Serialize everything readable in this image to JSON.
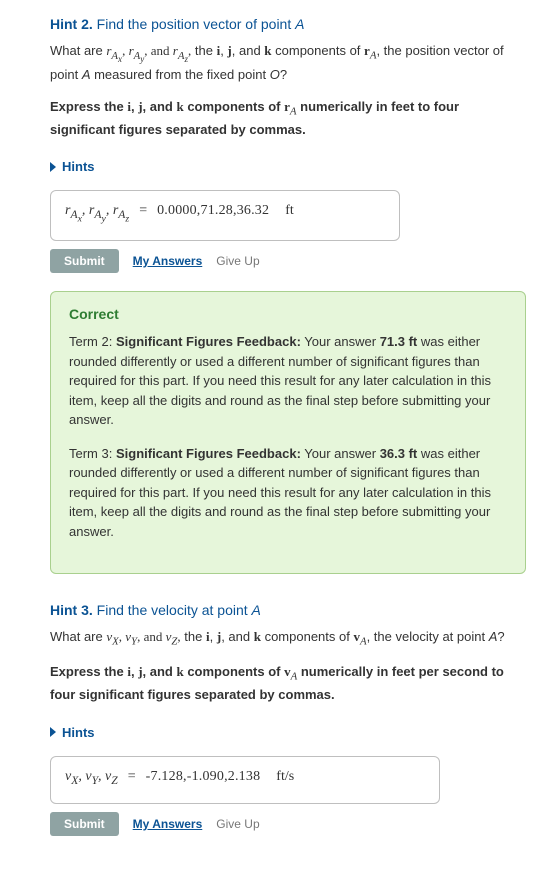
{
  "hint2": {
    "title_prefix": "Hint 2.",
    "title_rest": " Find the position vector of point ",
    "title_var": "A",
    "question_pre": "What are ",
    "vars_display": "r_{A_x}, r_{A_y}, and r_{A_z},",
    "question_mid": " the ",
    "ijk": "i, j, and k",
    "question_after_ijk": " components of ",
    "rA": "r_A",
    "question_tail": ", the position vector of point ",
    "A": "A",
    "question_end": " measured from the fixed point ",
    "O": "O",
    "qmark": "?",
    "instructions": "Express the i, j, and k components of r_A numerically in feet to four significant figures separated by commas.",
    "hints_label": "Hints",
    "answer_vars": "r_{A_x}, r_{A_y}, r_{A_z}",
    "answer_value": "0.0000,71.28,36.32",
    "answer_unit": "ft",
    "submit": "Submit",
    "my_answers": "My Answers",
    "give_up": "Give Up"
  },
  "feedback": {
    "correct": "Correct",
    "term2_label": "Term 2:",
    "sff_label": "Significant Figures Feedback:",
    "term2_lead": " Your answer ",
    "term2_val": "71.3 ft",
    "term2_tail": " was either rounded differently or used a different number of significant figures than required for this part. If you need this result for any later calculation in this item, keep all the digits and round as the final step before submitting your answer.",
    "term3_label": "Term 3:",
    "term3_val": "36.3 ft",
    "term3_tail": " was either rounded differently or used a different number of significant figures than required for this part. If you need this result for any later calculation in this item, keep all the digits and round as the final step before submitting your answer."
  },
  "hint3": {
    "title_prefix": "Hint 3.",
    "title_rest": " Find the velocity at point ",
    "title_var": "A",
    "question_pre": "What are ",
    "vars_display": "v_X, v_Y, and v_Z,",
    "question_mid": " the ",
    "ijk": "i, j, and k",
    "question_after_ijk": " components of ",
    "vA": "v_A",
    "question_tail": ", the velocity at point ",
    "A": "A",
    "qmark": "?",
    "instructions": "Express the i, j, and k components of v_A numerically in feet per second to four significant figures separated by commas.",
    "hints_label": "Hints",
    "answer_vars": "v_X, v_Y, v_Z",
    "answer_value": "-7.128,-1.090,2.138",
    "answer_unit": "ft/s",
    "submit": "Submit",
    "my_answers": "My Answers",
    "give_up": "Give Up"
  }
}
